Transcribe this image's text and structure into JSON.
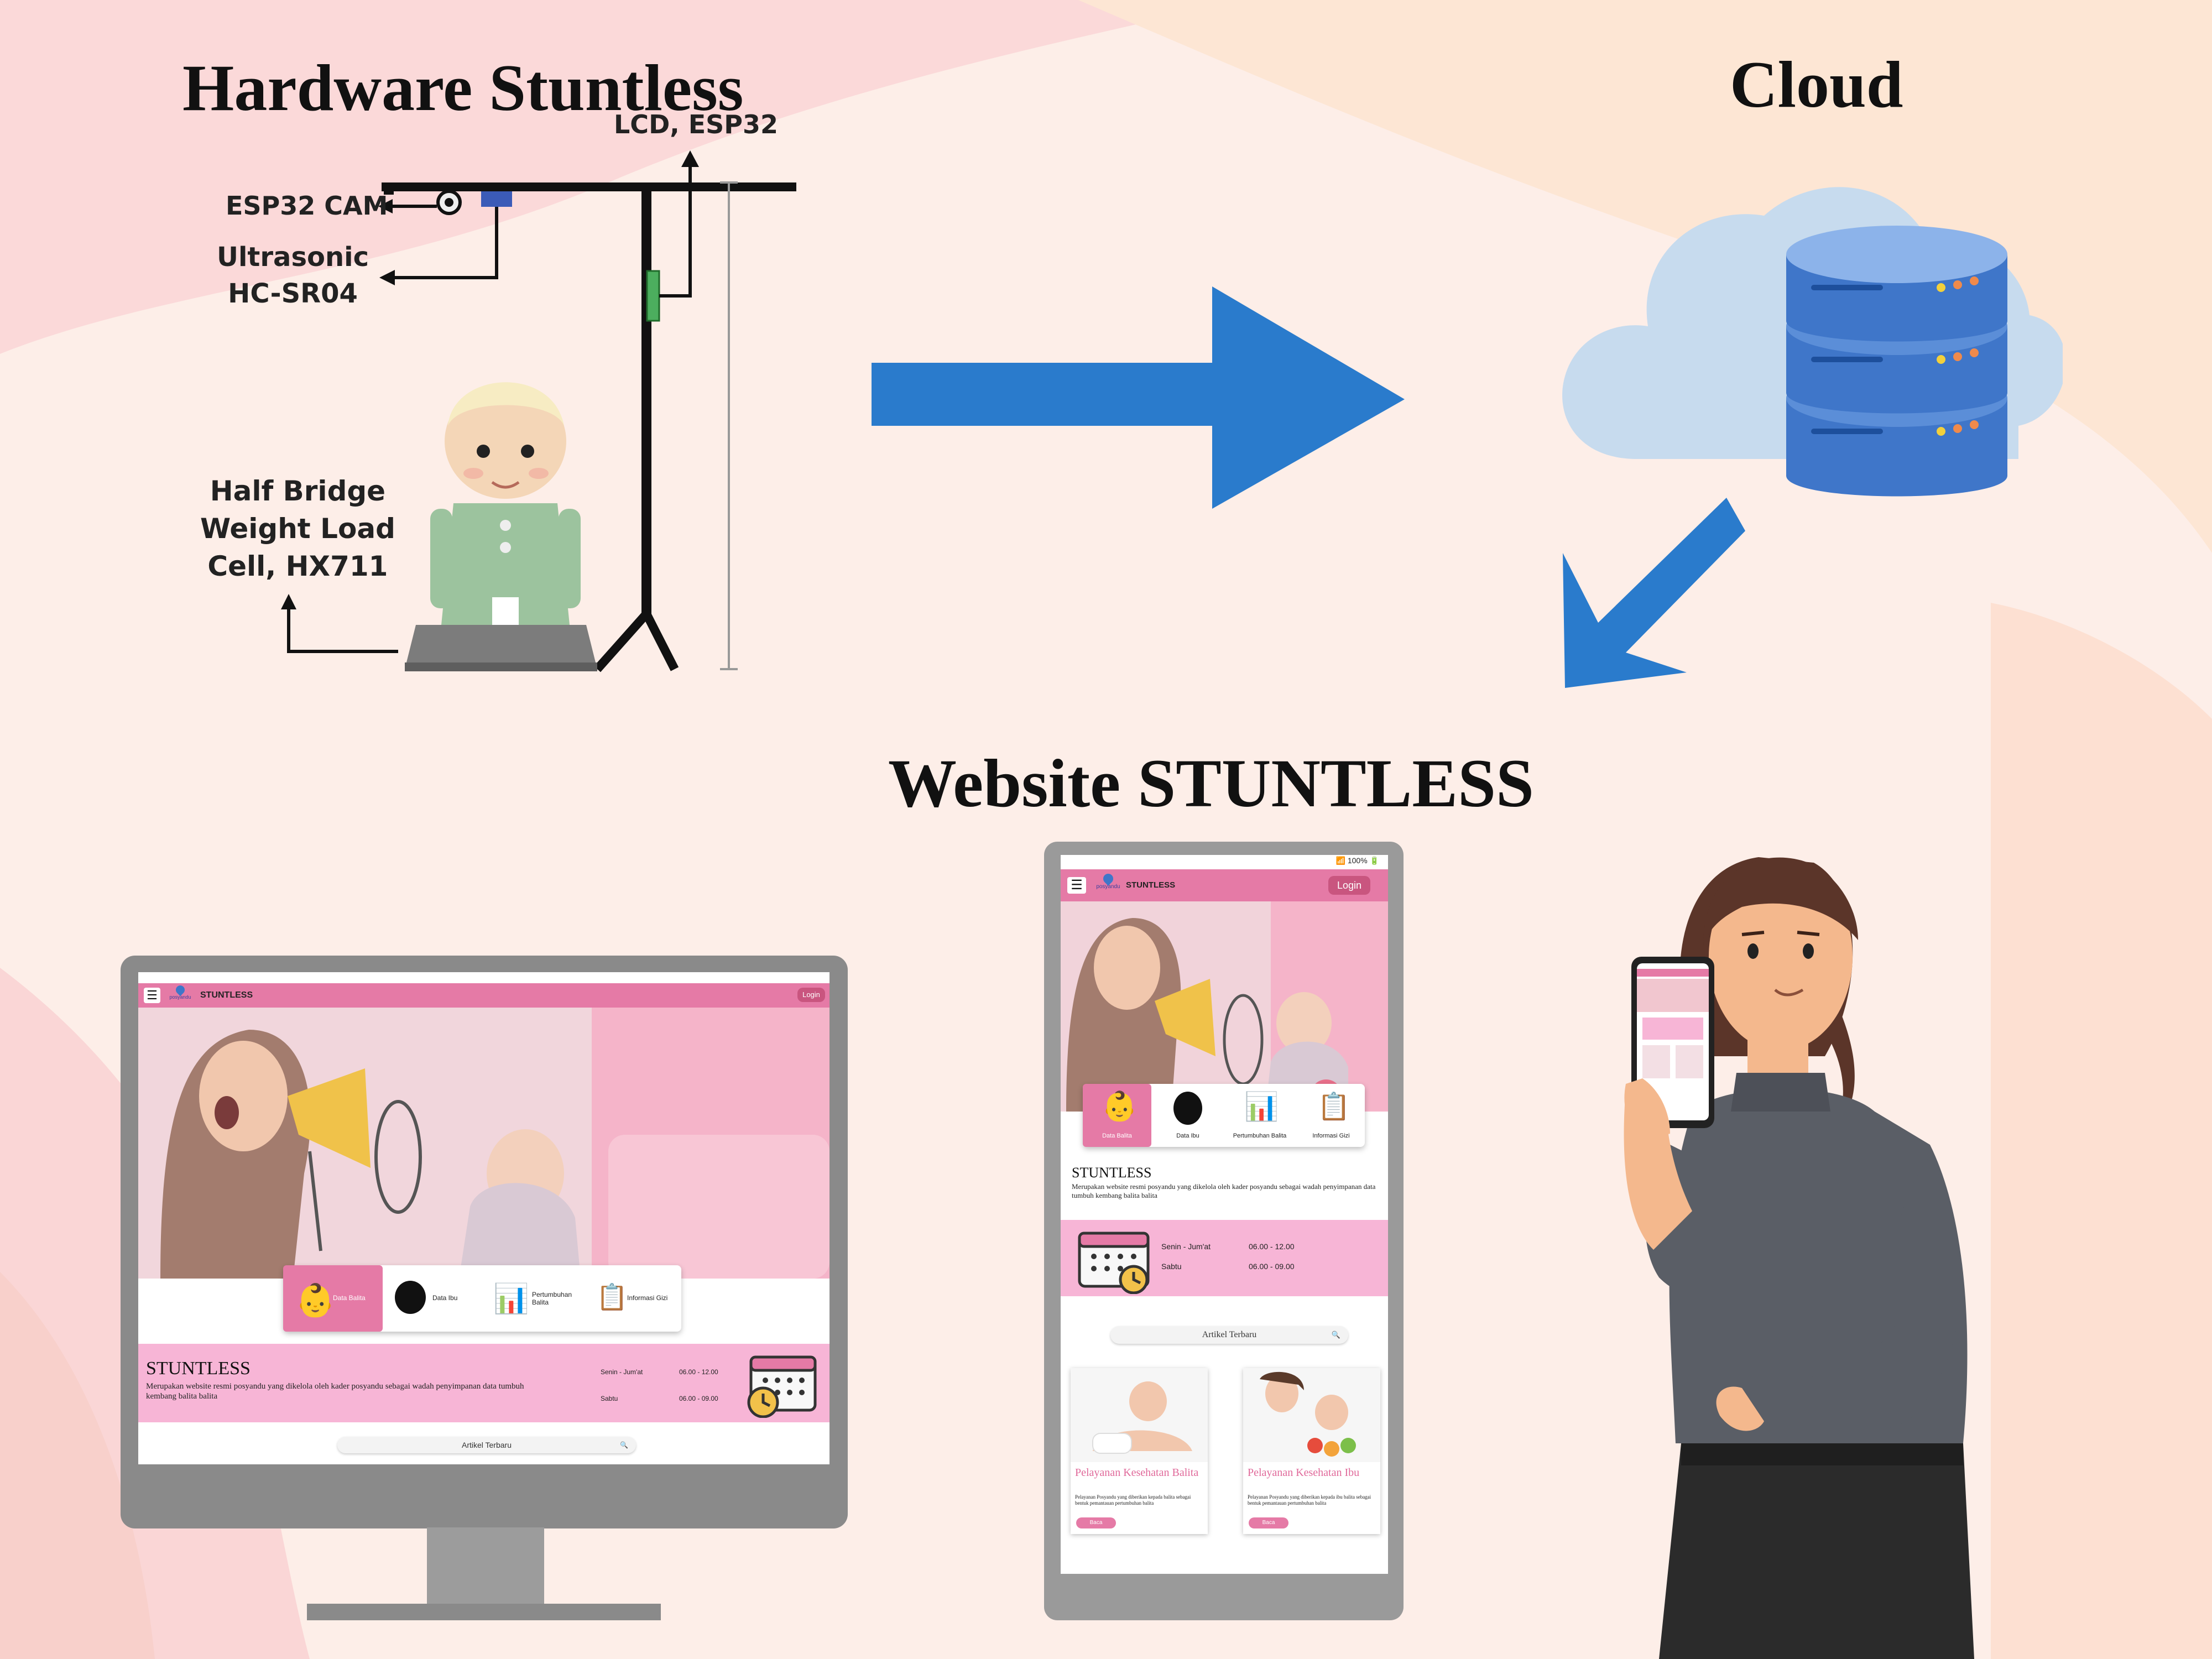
{
  "titles": {
    "hardware": "Hardware Stuntless",
    "cloud": "Cloud",
    "website": "Website STUNTLESS"
  },
  "hardware_labels": {
    "lcd": "LCD, ESP32",
    "cam": "ESP32 CAM",
    "ultrasonic_1": "Ultrasonic",
    "ultrasonic_2": "HC-SR04",
    "load_1": "Half Bridge",
    "load_2": "Weight Load",
    "load_3": "Cell, HX711"
  },
  "colors": {
    "arrow": "#2a7bcc",
    "accent_pink": "#e57aa6",
    "band_pink": "#f7b5d6",
    "cloud": "#c7dbee",
    "db": "#3f76c9"
  },
  "desktop": {
    "brand": "STUNTLESS",
    "logo_text": "posyandu",
    "login": "Login",
    "menu": [
      "Data Balita",
      "Data Ibu",
      "Pertumbuhan Balita",
      "Informasi Gizi"
    ],
    "heading": "STUNTLESS",
    "description": "Merupakan website resmi posyandu yang dikelola oleh kader posyandu sebagai wadah penyimpanan data tumbuh kembang balita balita",
    "schedule": [
      {
        "day": "Senin - Jum'at",
        "time": "06.00 - 12.00"
      },
      {
        "day": "Sabtu",
        "time": "06.00 - 09.00"
      }
    ],
    "search": "Artikel Terbaru"
  },
  "mobile": {
    "status": "100%",
    "brand": "STUNTLESS",
    "logo_text": "posyandu",
    "login": "Login",
    "menu": [
      "Data Balita",
      "Data Ibu",
      "Pertumbuhan Balita",
      "Informasi Gizi"
    ],
    "heading": "STUNTLESS",
    "description": "Merupakan website resmi posyandu yang dikelola oleh kader posyandu sebagai wadah penyimpanan data tumbuh kembang balita balita",
    "schedule": [
      {
        "day": "Senin - Jum'at",
        "time": "06.00 - 12.00"
      },
      {
        "day": "Sabtu",
        "time": "06.00 - 09.00"
      }
    ],
    "search": "Artikel Terbaru",
    "articles": [
      {
        "title": "Pelayanan Kesehatan Balita",
        "text": "Pelayanan Posyandu yang diberikan kepada balita sebagai bentuk pemantauan pertumbuhan balita",
        "button": "Baca"
      },
      {
        "title": "Pelayanan Kesehatan Ibu",
        "text": "Pelayanan Posyandu yang diberikan kepada ibu balita sebagai bentuk pemantauan pertumbuhan balita",
        "button": "Baca"
      }
    ]
  }
}
